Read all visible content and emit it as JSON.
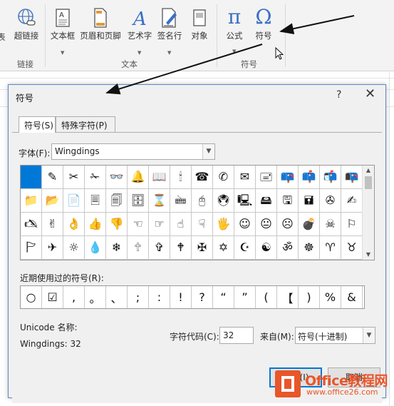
{
  "ribbon": {
    "buttons": [
      {
        "label": "超链接",
        "icon": "hyperlink-globe-icon"
      },
      {
        "label": "文本框",
        "icon": "textbox-icon"
      },
      {
        "label": "页眉和页脚",
        "icon": "header-footer-icon"
      },
      {
        "label": "艺术字",
        "icon": "wordart-icon"
      },
      {
        "label": "签名行",
        "icon": "signature-line-icon"
      },
      {
        "label": "对象",
        "icon": "object-icon"
      },
      {
        "label": "公式",
        "icon": "pi-icon",
        "glyph": "π"
      },
      {
        "label": "符号",
        "icon": "omega-icon",
        "glyph": "Ω"
      }
    ],
    "groups": {
      "links": "链接",
      "text": "文本",
      "symbols": "符号"
    },
    "left_cut_label": "表"
  },
  "dialog": {
    "title": "符号",
    "help": "?",
    "close": "✕",
    "tabs": [
      {
        "label": "符号(S)",
        "active": true
      },
      {
        "label": "特殊字符(P)",
        "active": false
      }
    ],
    "font_label": "字体(F):",
    "font_value": "Wingdings",
    "symbols": [
      [
        "",
        "✎",
        "✂",
        "✁",
        "👓",
        "🔔",
        "📖",
        "🕯",
        "☎",
        "✆",
        "✉",
        "🖃",
        "📪",
        "📫",
        "📬",
        "📭"
      ],
      [
        "📁",
        "📂",
        "📄",
        "🗏",
        "🗐",
        "🗄",
        "⌛",
        "🖮",
        "🖰",
        "🖲",
        "🖳",
        "🖴",
        "🖫",
        "🖬",
        "✇",
        "✍"
      ],
      [
        "🖎",
        "✌",
        "👌",
        "👍",
        "👎",
        "☜",
        "☞",
        "☝",
        "☟",
        "🖐",
        "☺",
        "😐",
        "☹",
        "💣",
        "☠",
        "⚐"
      ],
      [
        "🏱",
        "✈",
        "☼",
        "💧",
        "❄",
        "🕆",
        "✞",
        "🕈",
        "✠",
        "✡",
        "☪",
        "☯",
        "ॐ",
        "☸",
        "♈",
        "♉"
      ]
    ],
    "recent_label": "近期使用过的符号(R):",
    "recent": [
      "○",
      "☑",
      ",",
      "。",
      "、",
      ";",
      ":",
      "!",
      "?",
      "“",
      "”",
      "(",
      "【",
      ")",
      "%",
      "&"
    ],
    "unicode_name_label": "Unicode 名称:",
    "unicode_name_value": "Wingdings: 32",
    "char_code_label": "字符代码(C):",
    "char_code_value": "32",
    "from_label": "来自(M):",
    "from_value": "符号(十进制)",
    "insert_label": "插入(I)",
    "cancel_label": "取消"
  },
  "watermark": {
    "title": "Office教程网",
    "url": "www.office26.com"
  },
  "colors": {
    "selection": "#0078d7",
    "watermark": "#e8562a",
    "dialog_border": "#5a8ac6"
  }
}
